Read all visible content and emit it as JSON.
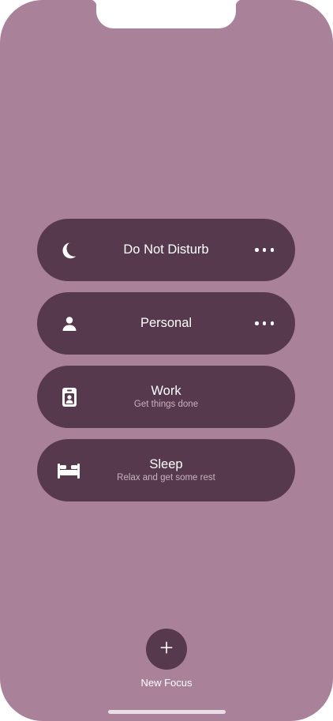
{
  "focus_modes": [
    {
      "title": "Do Not Disturb",
      "subtitle": "",
      "icon": "moon-icon",
      "has_more": true
    },
    {
      "title": "Personal",
      "subtitle": "",
      "icon": "person-icon",
      "has_more": true
    },
    {
      "title": "Work",
      "subtitle": "Get things done",
      "icon": "id-badge-icon",
      "has_more": false
    },
    {
      "title": "Sleep",
      "subtitle": "Relax and get some rest",
      "icon": "bed-icon",
      "has_more": false
    }
  ],
  "new_focus": {
    "label": "New Focus",
    "icon": "plus-icon"
  },
  "colors": {
    "background": "#a9829a",
    "card": "#57394d",
    "text": "#ffffff",
    "subtitle": "#c7b3bf"
  }
}
